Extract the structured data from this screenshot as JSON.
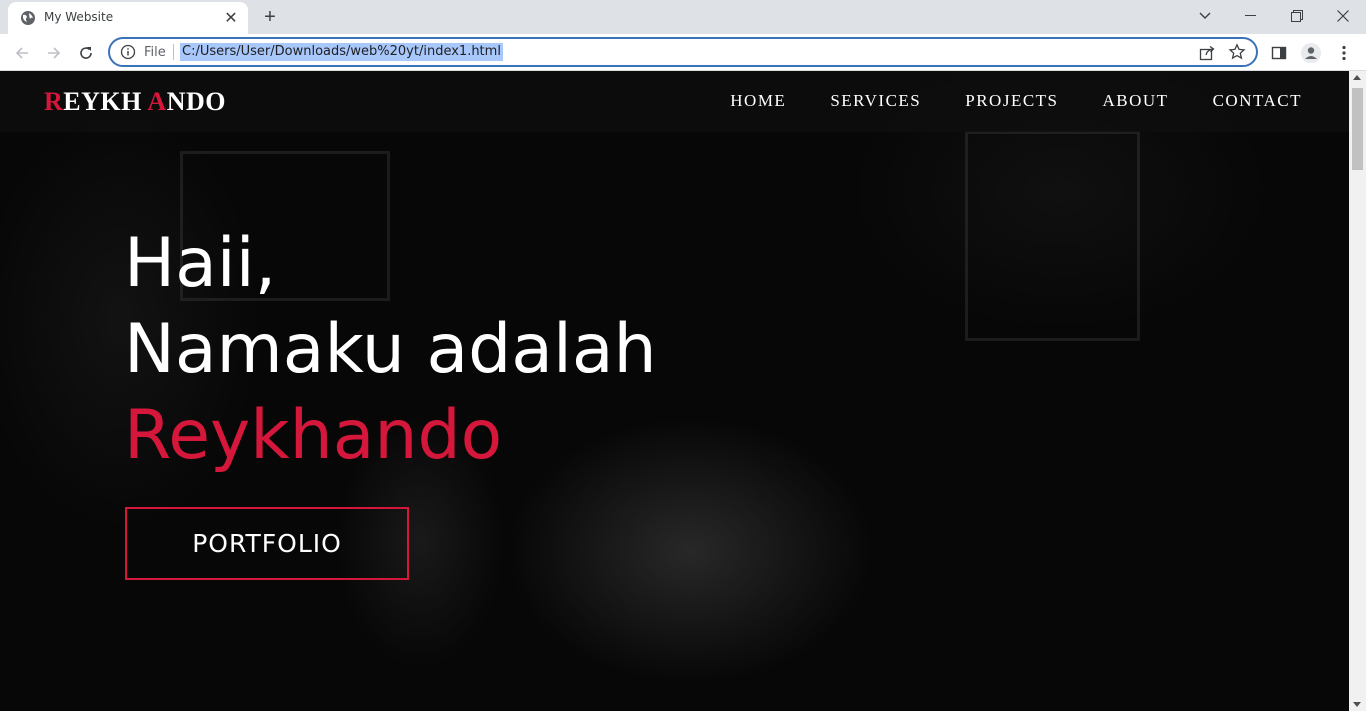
{
  "browser": {
    "tab_title": "My Website",
    "tab_favicon": "globe-icon",
    "omnibox": {
      "scheme_label": "File",
      "url": "C:/Users/User/Downloads/web%20yt/index1.html"
    },
    "icons": [
      "back-arrow-icon",
      "forward-arrow-icon",
      "reload-icon",
      "info-icon",
      "share-icon",
      "star-icon",
      "side-panel-icon",
      "profile-icon",
      "menu-dots-icon",
      "minimize-icon",
      "maximize-icon",
      "close-icon",
      "chevron-down-icon",
      "plus-icon"
    ]
  },
  "site": {
    "logo": {
      "part1_accent": "R",
      "part1_rest": "EYKH ",
      "part2_accent": "A",
      "part2_rest": "NDO"
    },
    "nav": [
      "HOME",
      "SERVICES",
      "PROJECTS",
      "ABOUT",
      "CONTACT"
    ],
    "hero": {
      "line1": "Haii,",
      "line2": "Namaku adalah",
      "name": "Reykhando",
      "button": "PORTFOLIO"
    }
  },
  "colors": {
    "accent": "#d6173c",
    "background": "#0a0a0a",
    "text": "#ffffff",
    "omnibox_border": "#3b73b9",
    "url_selection": "#a8c7fa"
  }
}
